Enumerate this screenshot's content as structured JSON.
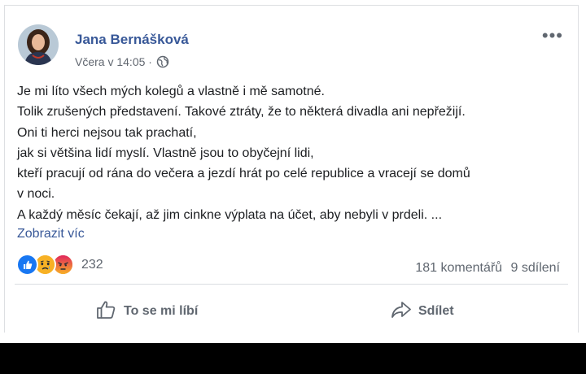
{
  "post": {
    "author": "Jana Bernášková",
    "time": "Včera v 14:05 ·",
    "lines": [
      "Je mi líto všech mých kolegů a vlastně i mě samotné.",
      "Tolik zrušených představení. Takové ztráty, že to některá divadla ani nepřežijí.",
      "Oni ti herci nejsou tak prachatí,",
      "jak si většina lidí myslí. Vlastně jsou to obyčejní lidi,",
      "kteří pracují od rána do večera a jezdí hrát po celé republice a vracejí se domů",
      "v noci.",
      "A každý měsíc čekají, až jim cinkne výplata na účet, aby nebyli v prdeli. ..."
    ],
    "see_more": "Zobrazit víc",
    "more_glyph": "•••"
  },
  "reactions": {
    "count": "232",
    "comments": "181 komentářů",
    "shares": "9 sdílení",
    "icons": [
      "like-reaction-icon",
      "sad-reaction-icon",
      "angry-reaction-icon"
    ],
    "colors": {
      "like": "#1877f2",
      "sad": "#f7b125",
      "angry": "#e9710f"
    }
  },
  "actions": {
    "like_label": "To se mi líbí",
    "share_label": "Sdílet"
  },
  "colors": {
    "author": "#385898",
    "meta": "#616770",
    "text": "#1c1e21"
  }
}
